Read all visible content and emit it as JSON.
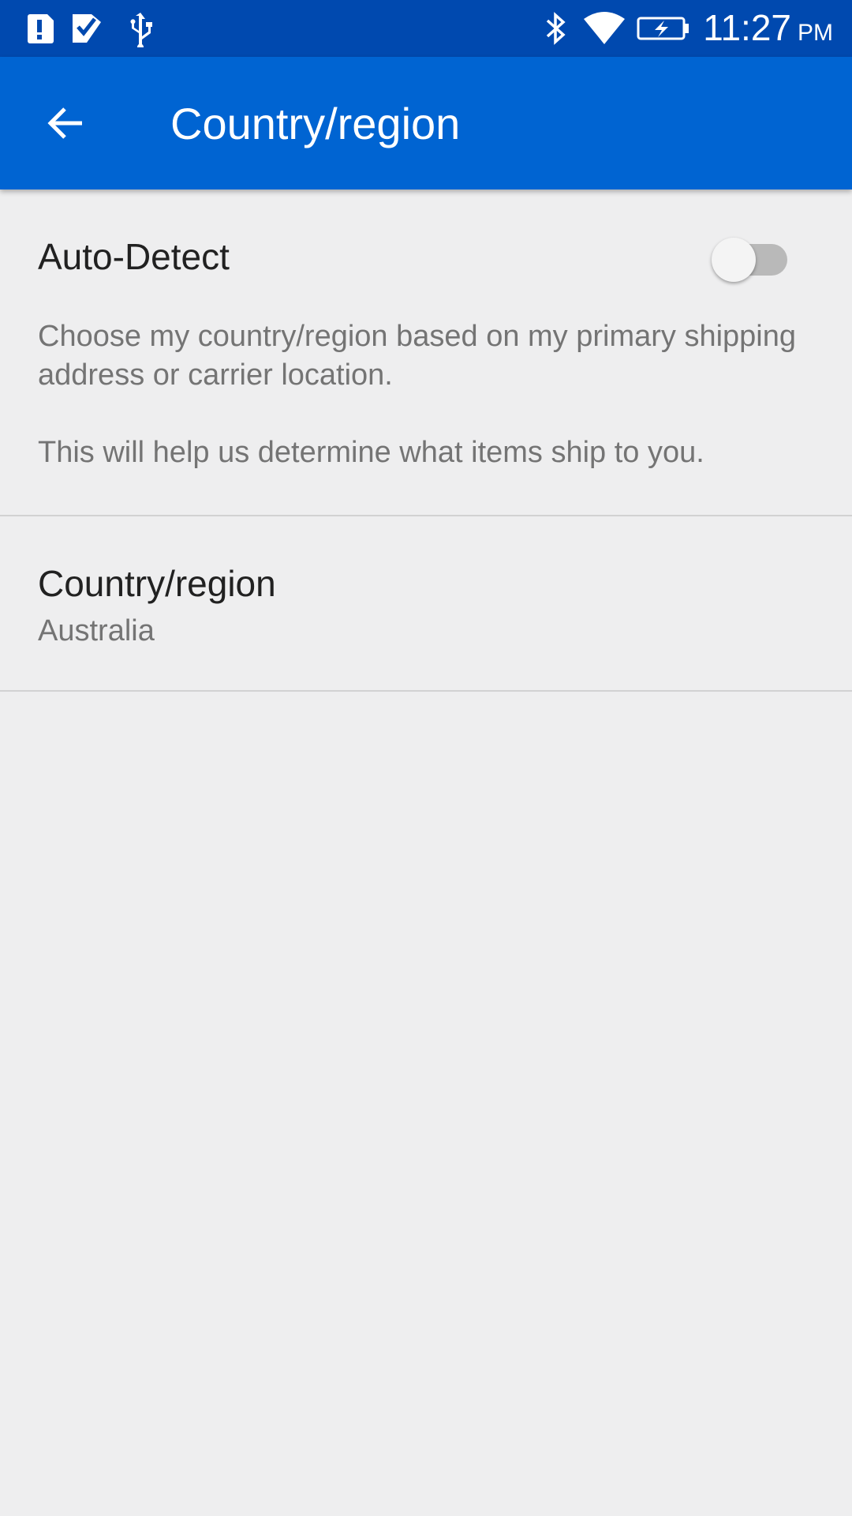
{
  "status_bar": {
    "time": "11:27",
    "ampm": "PM",
    "left_icons": [
      "alert-icon",
      "task-check-icon",
      "usb-icon"
    ],
    "right_icons": [
      "bluetooth-icon",
      "wifi-icon",
      "battery-charging-icon"
    ]
  },
  "app_bar": {
    "title": "Country/region",
    "back_icon": "back-arrow-icon",
    "color": "#0064d2"
  },
  "auto_detect": {
    "label": "Auto-Detect",
    "enabled": false,
    "description_1": "Choose my country/region based on my primary shipping address or carrier location.",
    "description_2": "This will help us determine what items ship to you."
  },
  "country": {
    "title": "Country/region",
    "value": "Australia"
  }
}
